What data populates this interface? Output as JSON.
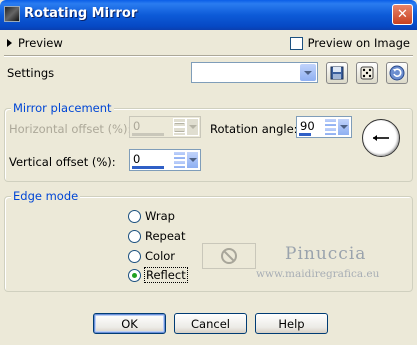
{
  "window": {
    "title": "Rotating Mirror",
    "close_label": "✕"
  },
  "preview": {
    "toggle_label": "Preview",
    "on_image_label": "Preview on Image",
    "on_image_checked": false
  },
  "settings": {
    "label": "Settings",
    "preset_value": "",
    "toolbar_icons": [
      "save-icon",
      "dice-icon",
      "reset-icon"
    ]
  },
  "mirror_placement": {
    "title": "Mirror placement",
    "horizontal_offset": {
      "label": "Horizontal offset (%):",
      "value": "0",
      "enabled": false,
      "level": 0.5
    },
    "vertical_offset": {
      "label": "Vertical offset (%):",
      "value": "0",
      "enabled": true,
      "level": 0.5
    },
    "rotation_angle": {
      "label": "Rotation angle:",
      "value": "90",
      "enabled": true,
      "level": 0.25
    },
    "dial_direction": "left"
  },
  "edge_mode": {
    "title": "Edge mode",
    "options": [
      {
        "label": "Wrap",
        "selected": false
      },
      {
        "label": "Repeat",
        "selected": false
      },
      {
        "label": "Color",
        "selected": false
      },
      {
        "label": "Reflect",
        "selected": true
      }
    ]
  },
  "watermark": {
    "name": "Pinuccia",
    "url": "www.maidiregrafica.eu"
  },
  "buttons": {
    "ok": "OK",
    "cancel": "Cancel",
    "help": "Help"
  },
  "colors": {
    "titlebar": "#0a5ee8",
    "group_title": "#0046d5",
    "dialog_bg": "#ece9d8",
    "slider_track": "#2f5fc6",
    "selected_radio": "#21a121"
  }
}
